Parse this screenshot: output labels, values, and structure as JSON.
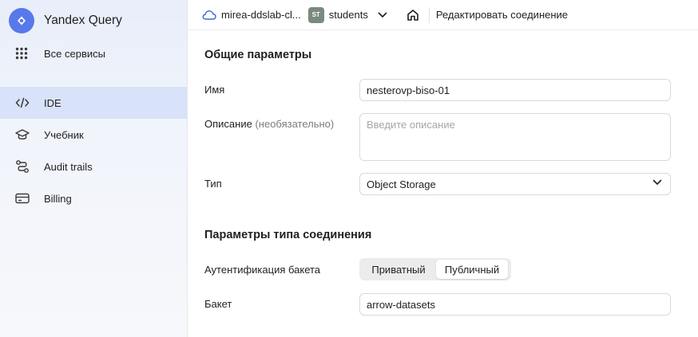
{
  "sidebar": {
    "brand": "Yandex Query",
    "all_services": "Все сервисы",
    "items": [
      {
        "label": "IDE",
        "icon": "code-icon"
      },
      {
        "label": "Учебник",
        "icon": "graduation-cap-icon"
      },
      {
        "label": "Audit trails",
        "icon": "route-icon"
      },
      {
        "label": "Billing",
        "icon": "credit-card-icon"
      }
    ]
  },
  "topbar": {
    "cloud": "mirea-ddslab-cl...",
    "folder_badge": "ST",
    "folder": "students",
    "page": "Редактировать соединение"
  },
  "form": {
    "general_title": "Общие параметры",
    "name_label": "Имя",
    "name_value": "nesterovp-biso-01",
    "desc_label": "Описание",
    "desc_optional": "(необязательно)",
    "desc_placeholder": "Введите описание",
    "type_label": "Тип",
    "type_value": "Object Storage",
    "conn_title": "Параметры типа соединения",
    "auth_label": "Аутентификация бакета",
    "auth_options": [
      "Приватный",
      "Публичный"
    ],
    "auth_selected": "Публичный",
    "bucket_label": "Бакет",
    "bucket_value": "arrow-datasets"
  },
  "colors": {
    "brand": "#5779ea",
    "active_nav": "#d8e2f8",
    "badge": "#7a8a7e"
  }
}
